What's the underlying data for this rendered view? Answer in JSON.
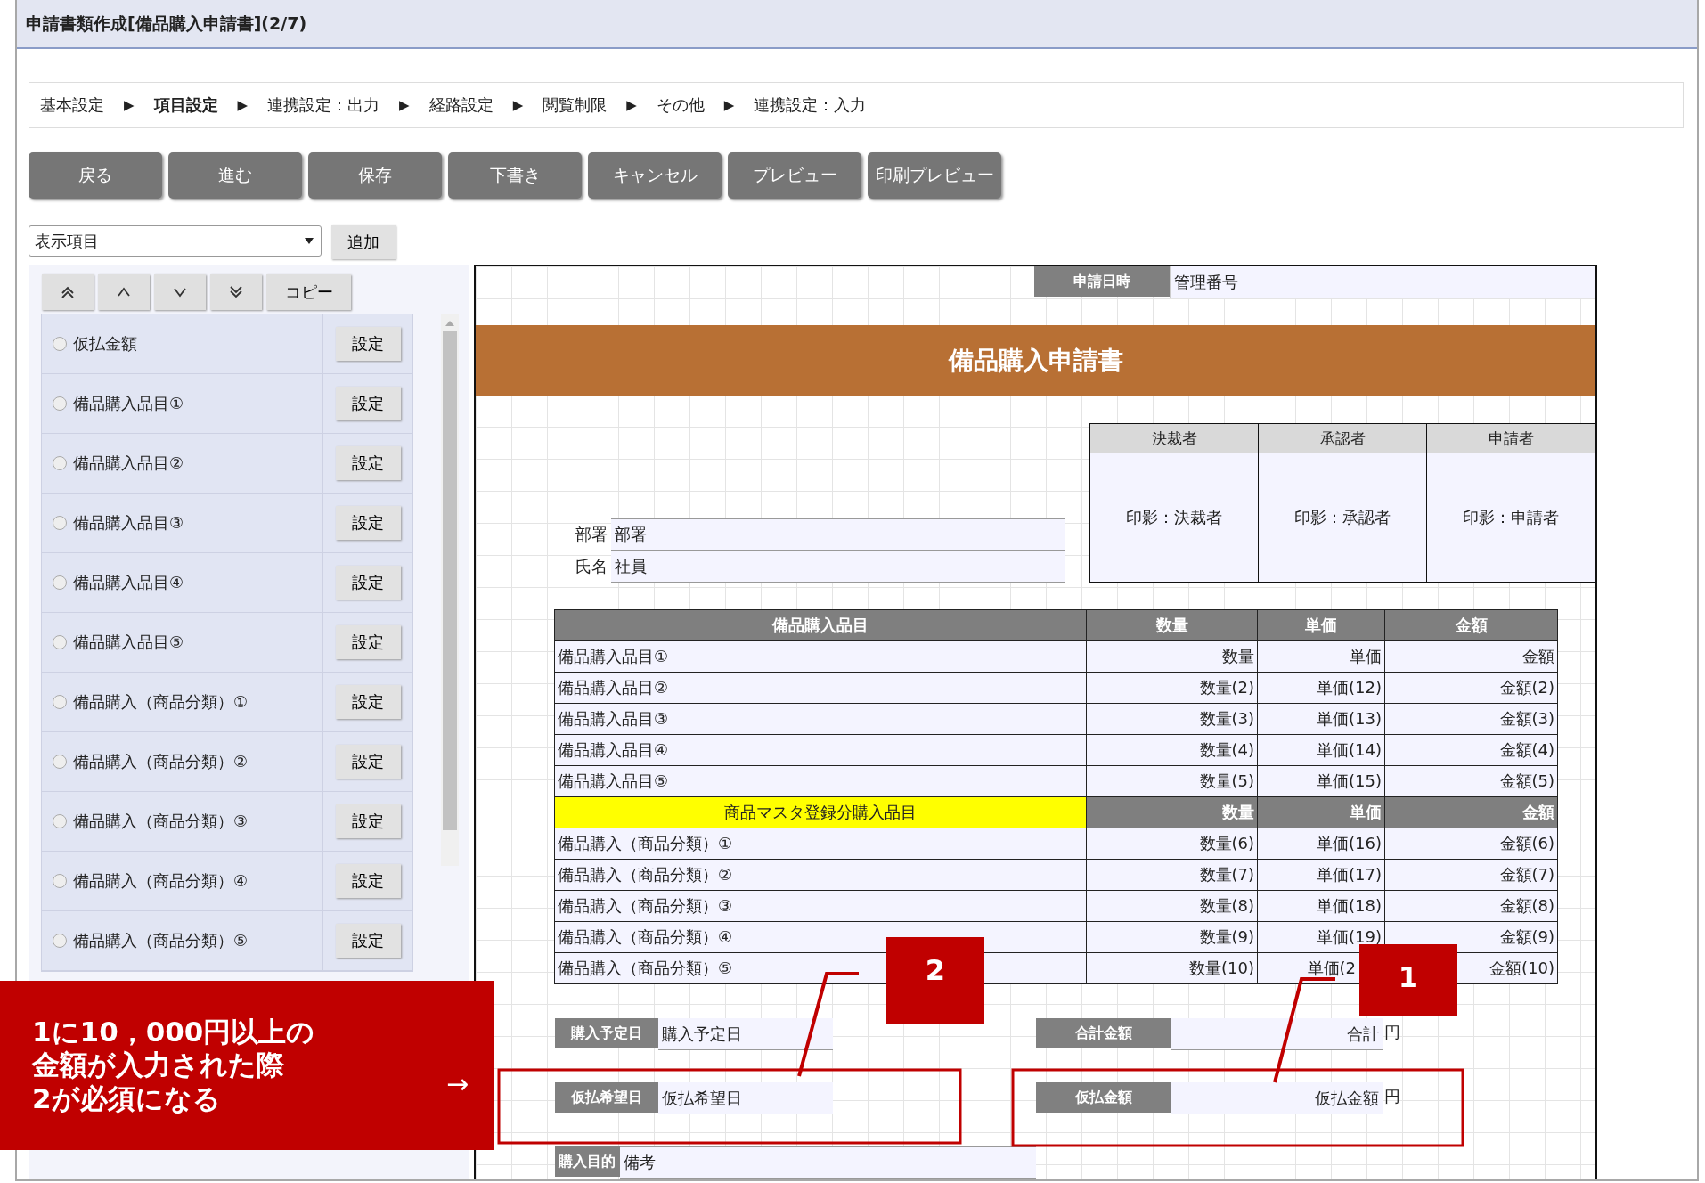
{
  "window": {
    "title": "申請書類作成[備品購入申請書](2/7)"
  },
  "steps": [
    {
      "label": "基本設定",
      "selected": false,
      "arrow": "▶"
    },
    {
      "label": "項目設定",
      "selected": true,
      "arrow": "▶"
    },
    {
      "label": "連携設定：出力",
      "selected": false,
      "arrow": "▶"
    },
    {
      "label": "経路設定",
      "selected": false,
      "arrow": "▶"
    },
    {
      "label": "閲覧制限",
      "selected": false,
      "arrow": "▶"
    },
    {
      "label": "その他",
      "selected": false,
      "arrow": "▶"
    },
    {
      "label": "連携設定：入力",
      "selected": false
    }
  ],
  "toolbar_buttons": [
    "戻る",
    "進む",
    "保存",
    "下書き",
    "キャンセル",
    "プレビュー",
    "印刷プレビュー"
  ],
  "field_select": {
    "value": "表示項目"
  },
  "add_button": "追加",
  "order_buttons": [
    {
      "kind": "top"
    },
    {
      "kind": "up"
    },
    {
      "kind": "down"
    },
    {
      "kind": "bottom"
    }
  ],
  "copy_button": "コピー",
  "items": [
    {
      "label": "仮払金額",
      "selected": false,
      "button": "設定"
    },
    {
      "label": "備品購入品目①",
      "selected": false,
      "button": "設定"
    },
    {
      "label": "備品購入品目②",
      "selected": false,
      "button": "設定"
    },
    {
      "label": "備品購入品目③",
      "selected": false,
      "button": "設定"
    },
    {
      "label": "備品購入品目④",
      "selected": false,
      "button": "設定"
    },
    {
      "label": "備品購入品目⑤",
      "selected": false,
      "button": "設定"
    },
    {
      "label": "備品購入（商品分類）①",
      "selected": false,
      "button": "設定"
    },
    {
      "label": "備品購入（商品分類）②",
      "selected": false,
      "button": "設定"
    },
    {
      "label": "備品購入（商品分類）③",
      "selected": false,
      "button": "設定"
    },
    {
      "label": "備品購入（商品分類）④",
      "selected": false,
      "button": "設定"
    },
    {
      "label": "備品購入（商品分類）⑤",
      "selected": false,
      "button": "設定"
    }
  ],
  "form": {
    "date_label": "申請日時",
    "number_field": "管理番号",
    "title": "備品購入申請書",
    "approvals": [
      {
        "role": "決裁者",
        "stamp": "印影：決裁者"
      },
      {
        "role": "承認者",
        "stamp": "印影：承認者"
      },
      {
        "role": "申請者",
        "stamp": "印影：申請者"
      }
    ],
    "fields": [
      {
        "label": "部署",
        "value": "部署"
      },
      {
        "label": "氏名",
        "value": "社員"
      }
    ],
    "items_table": {
      "columns": [
        "備品購入品目",
        "数量",
        "単価",
        "金額"
      ],
      "rows": [
        [
          "備品購入品目①",
          "数量",
          "単価",
          "金額"
        ],
        [
          "備品購入品目②",
          "数量(2)",
          "単価(12)",
          "金額(2)"
        ],
        [
          "備品購入品目③",
          "数量(3)",
          "単価(13)",
          "金額(3)"
        ],
        [
          "備品購入品目④",
          "数量(4)",
          "単価(14)",
          "金額(4)"
        ],
        [
          "備品購入品目⑤",
          "数量(5)",
          "単価(15)",
          "金額(5)"
        ]
      ],
      "subheader": [
        "商品マスタ登録分購入品目",
        "数量",
        "単価",
        "金額"
      ],
      "sub_rows": [
        [
          "備品購入（商品分類）①",
          "数量(6)",
          "単価(16)",
          "金額(6)"
        ],
        [
          "備品購入（商品分類）②",
          "数量(7)",
          "単価(17)",
          "金額(7)"
        ],
        [
          "備品購入（商品分類）③",
          "数量(8)",
          "単価(18)",
          "金額(8)"
        ],
        [
          "備品購入（商品分類）④",
          "数量(9)",
          "単価(19)",
          "金額(9)"
        ],
        [
          "備品購入（商品分類）⑤",
          "数量(10)",
          "単価(2",
          "金額(10)"
        ]
      ]
    },
    "bottom_rows": [
      [
        {
          "label": "購入予定日",
          "value": "購入予定日"
        },
        {
          "label": "合計金額",
          "value": "合計",
          "unit": "円"
        }
      ],
      [
        {
          "label": "仮払希望日",
          "value": "仮払希望日"
        },
        {
          "label": "仮払金額",
          "value": "仮払金額",
          "unit": "円"
        }
      ]
    ],
    "purpose": {
      "label": "購入目的",
      "value": "備考"
    }
  },
  "annotation": {
    "note_lines": [
      "1に10，000円以上の",
      "金額が入力された際",
      "2が必須になる"
    ],
    "arrow": "→",
    "badges": [
      "2",
      "1"
    ]
  }
}
